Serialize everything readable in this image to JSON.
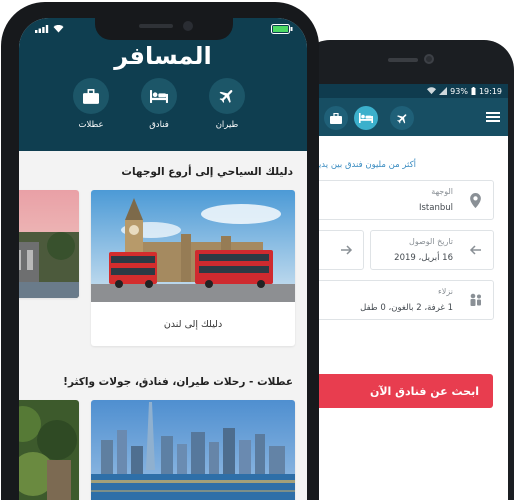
{
  "back_app": {
    "status_bar": {
      "battery": "93%",
      "time": "19:19"
    },
    "tagline": "أكثر من مليون فندق بين يديك",
    "destination": {
      "label": "الوجهة",
      "value": "Istanbul"
    },
    "arrival": {
      "label": "تاريخ الوصول",
      "value": "16 أبريل، 2019"
    },
    "guests": {
      "label": "نزلاء",
      "value": "1 غرفة، 2 بالغون، 0 طفل"
    },
    "search_button": "ابحث عن فنادق الآن"
  },
  "front_app": {
    "brand": "المسافر",
    "categories": [
      {
        "label": "طيران",
        "icon": "plane-icon"
      },
      {
        "label": "فنادق",
        "icon": "bed-icon"
      },
      {
        "label": "عطلات",
        "icon": "suitcase-icon"
      }
    ],
    "section_guide": {
      "title": "دليلك السياحي إلى أروع الوجهات",
      "card_caption": "دليلك إلى لندن"
    },
    "section_holidays": {
      "title": "عطلات - رحلات طيران، فنادق، جولات واكثر!"
    }
  },
  "colors": {
    "header_dark": "#0f3e50",
    "back_header": "#174e63",
    "accent_teal": "#3cb0cc",
    "search_red": "#e83d4f",
    "link_blue": "#3a8cc1"
  }
}
